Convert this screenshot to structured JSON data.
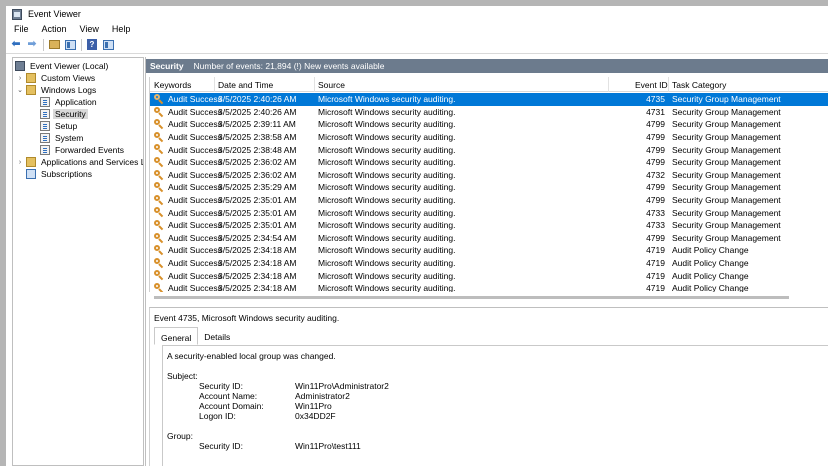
{
  "window": {
    "title": "Event Viewer"
  },
  "menu": [
    "File",
    "Action",
    "View",
    "Help"
  ],
  "toolbar": {
    "icons": [
      "back-arrow",
      "forward-arrow",
      "folder",
      "show-hide-pane",
      "help",
      "properties-pane"
    ]
  },
  "tree": {
    "items": [
      {
        "label": "Event Viewer (Local)",
        "toggle": "",
        "icon": "event-viewer-icon"
      },
      {
        "label": "Custom Views",
        "toggle": "›",
        "icon": "folder-icon"
      },
      {
        "label": "Windows Logs",
        "toggle": "⌄",
        "icon": "folder-icon"
      },
      {
        "label": "Application",
        "toggle": "",
        "icon": "log-icon"
      },
      {
        "label": "Security",
        "toggle": "",
        "icon": "log-icon",
        "selected": true
      },
      {
        "label": "Setup",
        "toggle": "",
        "icon": "log-icon"
      },
      {
        "label": "System",
        "toggle": "",
        "icon": "log-icon"
      },
      {
        "label": "Forwarded Events",
        "toggle": "",
        "icon": "log-icon"
      },
      {
        "label": "Applications and Services Lo",
        "toggle": "›",
        "icon": "folder-icon"
      },
      {
        "label": "Subscriptions",
        "toggle": "",
        "icon": "subscriptions-icon"
      }
    ]
  },
  "pane_header": {
    "title": "Security",
    "info": "Number of events: 21,894 (!) New events available"
  },
  "grid": {
    "columns": [
      "Keywords",
      "Date and Time",
      "Source",
      "Event ID",
      "Task Category"
    ],
    "rows": [
      [
        "Audit Success",
        "3/5/2025 2:40:26 AM",
        "Microsoft Windows security auditing.",
        "4735",
        "Security Group Management"
      ],
      [
        "Audit Success",
        "3/5/2025 2:40:26 AM",
        "Microsoft Windows security auditing.",
        "4731",
        "Security Group Management"
      ],
      [
        "Audit Success",
        "3/5/2025 2:39:11 AM",
        "Microsoft Windows security auditing.",
        "4799",
        "Security Group Management"
      ],
      [
        "Audit Success",
        "3/5/2025 2:38:58 AM",
        "Microsoft Windows security auditing.",
        "4799",
        "Security Group Management"
      ],
      [
        "Audit Success",
        "3/5/2025 2:38:48 AM",
        "Microsoft Windows security auditing.",
        "4799",
        "Security Group Management"
      ],
      [
        "Audit Success",
        "3/5/2025 2:36:02 AM",
        "Microsoft Windows security auditing.",
        "4799",
        "Security Group Management"
      ],
      [
        "Audit Success",
        "3/5/2025 2:36:02 AM",
        "Microsoft Windows security auditing.",
        "4732",
        "Security Group Management"
      ],
      [
        "Audit Success",
        "3/5/2025 2:35:29 AM",
        "Microsoft Windows security auditing.",
        "4799",
        "Security Group Management"
      ],
      [
        "Audit Success",
        "3/5/2025 2:35:01 AM",
        "Microsoft Windows security auditing.",
        "4799",
        "Security Group Management"
      ],
      [
        "Audit Success",
        "3/5/2025 2:35:01 AM",
        "Microsoft Windows security auditing.",
        "4733",
        "Security Group Management"
      ],
      [
        "Audit Success",
        "3/5/2025 2:35:01 AM",
        "Microsoft Windows security auditing.",
        "4733",
        "Security Group Management"
      ],
      [
        "Audit Success",
        "3/5/2025 2:34:54 AM",
        "Microsoft Windows security auditing.",
        "4799",
        "Security Group Management"
      ],
      [
        "Audit Success",
        "3/5/2025 2:34:18 AM",
        "Microsoft Windows security auditing.",
        "4719",
        "Audit Policy Change"
      ],
      [
        "Audit Success",
        "3/5/2025 2:34:18 AM",
        "Microsoft Windows security auditing.",
        "4719",
        "Audit Policy Change"
      ],
      [
        "Audit Success",
        "3/5/2025 2:34:18 AM",
        "Microsoft Windows security auditing.",
        "4719",
        "Audit Policy Change"
      ],
      [
        "Audit Success",
        "3/5/2025 2:34:18 AM",
        "Microsoft Windows security auditing.",
        "4719",
        "Audit Policy Change"
      ]
    ],
    "selected_index": 0
  },
  "detail": {
    "title": "Event 4735, Microsoft Windows security auditing.",
    "tabs": [
      "General",
      "Details"
    ],
    "active_tab": "General",
    "description": "A security-enabled local group was changed.",
    "subject_heading": "Subject:",
    "subject": [
      {
        "label": "Security ID:",
        "value": "Win11Pro\\Administrator2"
      },
      {
        "label": "Account Name:",
        "value": "Administrator2"
      },
      {
        "label": "Account Domain:",
        "value": "Win11Pro"
      },
      {
        "label": "Logon ID:",
        "value": "0x34DD2F"
      }
    ],
    "group_heading": "Group:",
    "group": [
      {
        "label": "Security ID:",
        "value": "Win11Pro\\test111"
      }
    ]
  },
  "colors": {
    "selection": "#0078d7",
    "pane_header": "#6c7b8d",
    "key_icon": "#d8902a"
  }
}
